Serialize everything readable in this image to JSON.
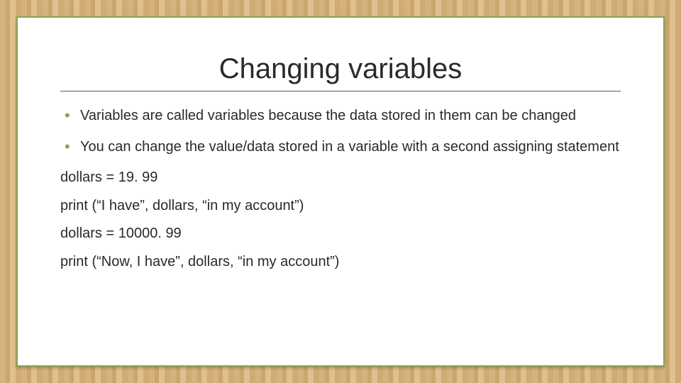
{
  "slide": {
    "title": "Changing variables",
    "bullets": [
      "Variables are called variables because the data stored in them can be changed",
      "You can change the value/data stored in a variable with a second assigning statement"
    ],
    "code": [
      "dollars = 19. 99",
      "print (“I have”, dollars, “in my account”)",
      "dollars = 10000. 99",
      "print (“Now, I have”, dollars, “in my account”)"
    ]
  }
}
